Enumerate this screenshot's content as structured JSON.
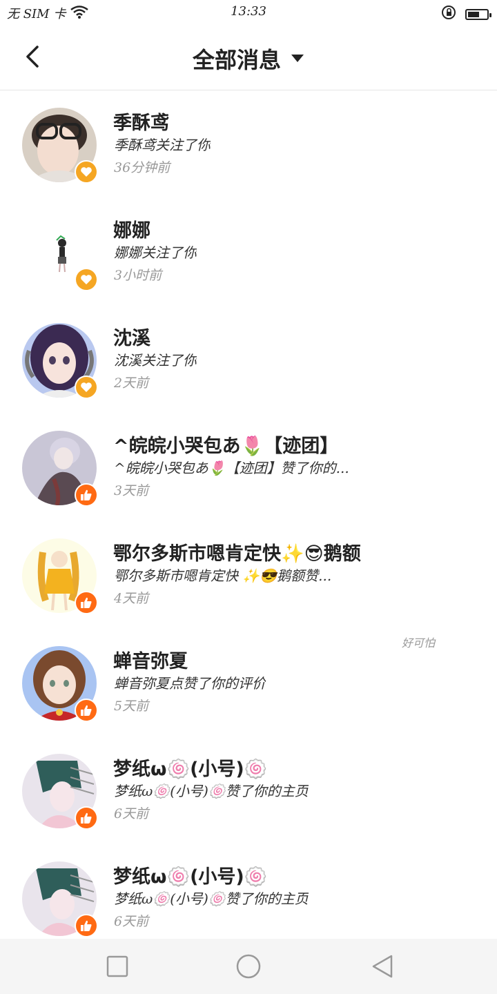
{
  "status_bar": {
    "carrier": "无 SIM 卡",
    "time": "13:33",
    "icons": [
      "wifi-icon",
      "rotation-lock-icon",
      "battery-icon"
    ],
    "battery_level": 0.6
  },
  "header": {
    "back_icon": "back-arrow-icon",
    "title": "全部消息",
    "dropdown_icon": "caret-down-icon"
  },
  "messages": [
    {
      "name": "季酥鸢",
      "text": "季酥鸢关注了你",
      "time": "36分钟前",
      "badge": "heart-icon",
      "extra": ""
    },
    {
      "name": "娜娜",
      "text": "娜娜关注了你",
      "time": "3小时前",
      "badge": "heart-icon",
      "extra": ""
    },
    {
      "name": "沈溪",
      "text": "沈溪关注了你",
      "time": "2天前",
      "badge": "heart-icon",
      "extra": ""
    },
    {
      "name": "^皖皖小哭包あ🌷【迹团】",
      "text": "^皖皖小哭包あ🌷【迹团】赞了你的...",
      "time": "3天前",
      "badge": "thumbs-up-icon",
      "extra": ""
    },
    {
      "name": "鄂尔多斯市嗯肯定快✨😎鹅额",
      "text": "鄂尔多斯市嗯肯定快 ✨😎鹅额赞...",
      "time": "4天前",
      "badge": "thumbs-up-icon",
      "extra": ""
    },
    {
      "name": "蝉音弥夏",
      "text": "蝉音弥夏点赞了你的评价",
      "time": "5天前",
      "badge": "thumbs-up-icon",
      "extra": "好可怕"
    },
    {
      "name": "梦纸ω🍥(小号)🍥",
      "text": "梦纸ω🍥(小号)🍥赞了你的主页",
      "time": "6天前",
      "badge": "thumbs-up-icon",
      "extra": ""
    },
    {
      "name": "梦纸ω🍥(小号)🍥",
      "text": "梦纸ω🍥(小号)🍥赞了你的主页",
      "time": "6天前",
      "badge": "thumbs-up-icon",
      "extra": ""
    }
  ],
  "bottom_nav": {
    "items": [
      "recent-apps-icon",
      "home-icon",
      "back-triangle-icon"
    ]
  },
  "colors": {
    "heart_badge": "#f5a623",
    "like_badge": "#ff6a13",
    "nav_background": "#f5f5f5"
  }
}
